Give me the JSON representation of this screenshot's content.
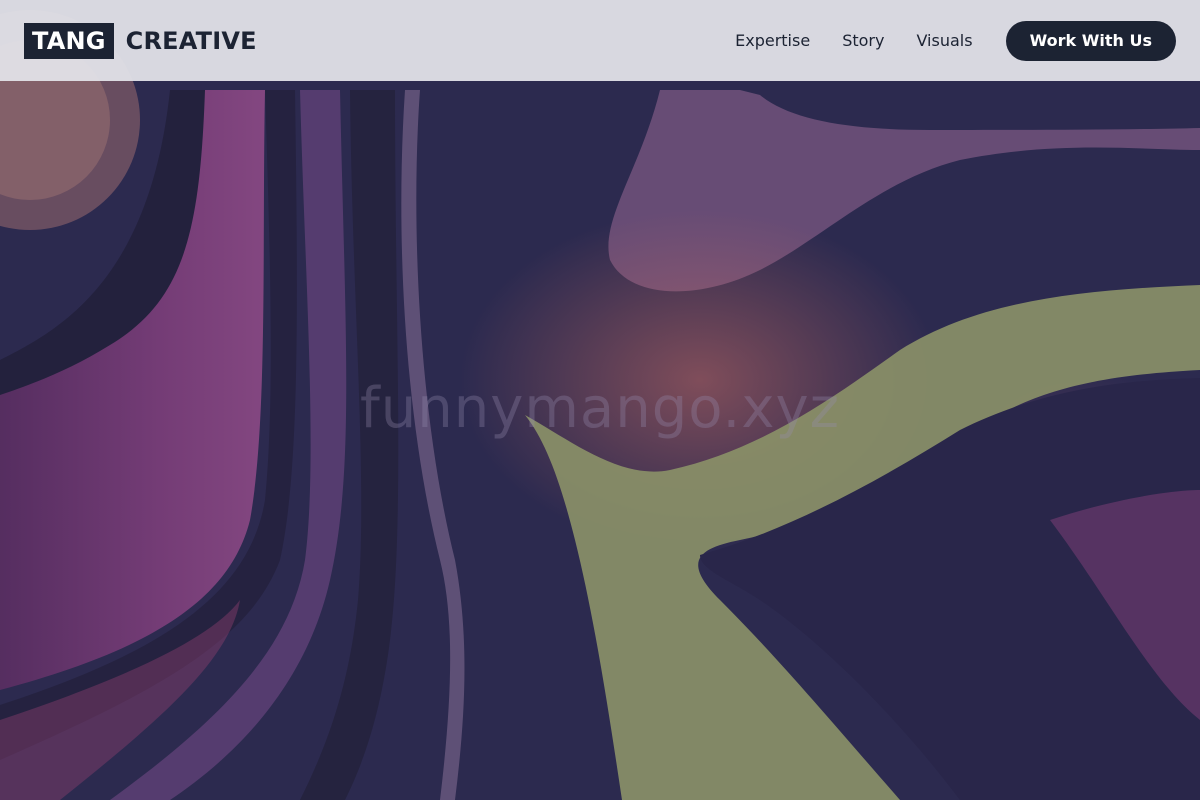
{
  "header": {
    "logo_box_text": "TANG",
    "logo_word": "CREATIVE",
    "nav": [
      {
        "label": "Expertise"
      },
      {
        "label": "Story"
      },
      {
        "label": "Visuals"
      }
    ],
    "cta_label": "Work With Us"
  },
  "hero": {
    "watermark": "funnymango.xyz"
  },
  "colors": {
    "brand_dark": "#1c2333",
    "header_bg": "#e2e2e8",
    "hero_base": "#2c2a4f",
    "hero_purple": "#7a3d78",
    "hero_green": "#8a9068"
  }
}
